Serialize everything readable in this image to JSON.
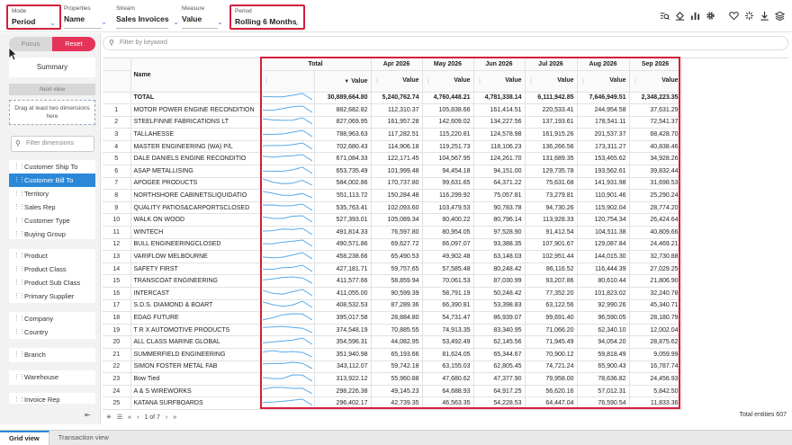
{
  "toolbar": {
    "mode": {
      "label": "Mode",
      "value": "Period"
    },
    "properties": {
      "label": "Properties",
      "value": "Name"
    },
    "stream": {
      "label": "Stream",
      "value": "Sales Invoices"
    },
    "measure": {
      "label": "Measure",
      "value": "Value"
    },
    "period": {
      "label": "Period",
      "value": "Rolling 6 Months"
    },
    "icons": [
      "search-list-icon",
      "paint-bucket-icon",
      "bar-chart-icon",
      "gear-icon",
      "heart-icon",
      "sparkle-icon",
      "download-icon",
      "layers-icon"
    ]
  },
  "left": {
    "focus_label": "Focus",
    "reset_label": "Reset",
    "summary_label": "Summary",
    "next_view_label": "Next view",
    "drag_hint": "Drag at least two dimensions here",
    "filter_placeholder": "Filter dimensions",
    "groups": [
      [
        "Customer Ship To",
        "Customer Bill To",
        "Territory",
        "Sales Rep",
        "Customer Type",
        "Buying Group"
      ],
      [
        "Product",
        "Product Class",
        "Product Sub Class",
        "Primary Supplier"
      ],
      [
        "Company",
        "Country"
      ],
      [
        "Branch"
      ],
      [
        "Warehouse"
      ],
      [
        "Invoice Rep"
      ]
    ],
    "selected": "Customer Bill To"
  },
  "search": {
    "placeholder": "Filter by keyword"
  },
  "grid": {
    "name_header": "Name",
    "value_header": "Value",
    "columns": [
      "Total",
      "Apr 2026",
      "May 2026",
      "Jun 2026",
      "Jul 2026",
      "Aug 2026",
      "Sep 2026"
    ],
    "total_row": {
      "name": "TOTAL",
      "values": [
        "30,889,664.80",
        "5,240,762.74",
        "4,760,448.21",
        "4,781,338.14",
        "6,111,942.85",
        "7,646,949.51",
        "2,348,223.35"
      ]
    },
    "rows": [
      {
        "i": "1",
        "name": "MOTOR POWER ENGINE RECONDITION",
        "values": [
          "882,682.82",
          "112,310.37",
          "105,838.66",
          "161,414.51",
          "220,533.41",
          "244,954.58",
          "37,631.29"
        ]
      },
      {
        "i": "2",
        "name": "STEELFINNE FABRICATIONS LT",
        "values": [
          "827,069.95",
          "161,957.28",
          "142,609.02",
          "134,227.56",
          "137,193.61",
          "178,541.11",
          "72,541.37"
        ]
      },
      {
        "i": "3",
        "name": "TALLAHESSE",
        "values": [
          "788,963.63",
          "117,282.51",
          "115,220.81",
          "124,578.98",
          "161,915.26",
          "201,537.37",
          "68,428.70"
        ]
      },
      {
        "i": "4",
        "name": "MASTER ENGINEERING (WA) P/L",
        "values": [
          "702,680.43",
          "114,906.18",
          "119,251.73",
          "118,106.23",
          "136,266.56",
          "173,311.27",
          "40,838.46"
        ]
      },
      {
        "i": "5",
        "name": "DALE DANIELS ENGINE RECONDITIO",
        "values": [
          "671,084.33",
          "122,171.45",
          "104,567.95",
          "124,261.70",
          "131,689.35",
          "153,465.62",
          "34,928.26"
        ]
      },
      {
        "i": "6",
        "name": "ASAP METALLISING",
        "values": [
          "653,735.49",
          "101,999.48",
          "94,454.18",
          "94,151.00",
          "129,735.78",
          "193,562.61",
          "39,832.44"
        ]
      },
      {
        "i": "7",
        "name": "APOGEE PRODUCTS",
        "values": [
          "584,002.86",
          "170,737.80",
          "99,631.65",
          "64,371.22",
          "75,631.68",
          "141,931.98",
          "31,698.53"
        ]
      },
      {
        "i": "8",
        "name": "NORTHSHORE CABINETSLIQUIDATIO",
        "values": [
          "551,113.72",
          "150,284.48",
          "116,299.92",
          "75,057.81",
          "73,279.81",
          "110,901.46",
          "25,290.24"
        ]
      },
      {
        "i": "9",
        "name": "QUALITY PATIOS&CARPORTSCLOSED",
        "values": [
          "535,763.41",
          "102,093.60",
          "103,479.53",
          "90,783.78",
          "94,730.26",
          "115,902.04",
          "28,774.20"
        ]
      },
      {
        "i": "10",
        "name": "WALK ON WOOD",
        "values": [
          "527,393.01",
          "105,089.34",
          "80,400.22",
          "80,796.14",
          "113,928.33",
          "120,754.34",
          "26,424.64"
        ]
      },
      {
        "i": "11",
        "name": "WINTECH",
        "values": [
          "491,814.33",
          "76,597.80",
          "80,954.05",
          "97,528.90",
          "91,412.54",
          "104,511.38",
          "40,809.66"
        ]
      },
      {
        "i": "12",
        "name": "BULL ENGINEERINGCLOSED",
        "values": [
          "490,571.86",
          "69,627.72",
          "66,097.07",
          "93,388.35",
          "107,901.67",
          "129,087.84",
          "24,469.21"
        ]
      },
      {
        "i": "13",
        "name": "VARIFLOW MELBOURNE",
        "values": [
          "458,238.66",
          "65,490.53",
          "49,902.48",
          "63,148.03",
          "102,951.44",
          "144,015.30",
          "32,730.88"
        ]
      },
      {
        "i": "14",
        "name": "SAFETY FIRST",
        "values": [
          "427,181.71",
          "59,757.65",
          "57,585.48",
          "80,248.42",
          "86,116.52",
          "116,444.39",
          "27,029.25"
        ]
      },
      {
        "i": "15",
        "name": "TRANSCOAT ENGINEERING",
        "values": [
          "411,577.66",
          "58,859.94",
          "70,061.53",
          "87,030.99",
          "93,207.86",
          "80,610.44",
          "21,806.90"
        ]
      },
      {
        "i": "16",
        "name": "INTERCAST",
        "values": [
          "411,055.00",
          "90,599.39",
          "58,791.19",
          "50,248.42",
          "77,352.20",
          "101,823.02",
          "32,240.78"
        ]
      },
      {
        "i": "17",
        "name": "S.D.S. DIAMOND & BOART",
        "values": [
          "408,532.53",
          "87,289.36",
          "66,390.81",
          "53,398.83",
          "63,122.56",
          "92,990.26",
          "45,340.71"
        ]
      },
      {
        "i": "18",
        "name": "EDAG FUTURE",
        "values": [
          "395,017.58",
          "28,884.80",
          "54,731.47",
          "86,939.07",
          "99,691.40",
          "96,590.05",
          "28,180.79"
        ]
      },
      {
        "i": "19",
        "name": "T R X AUTOMOTIVE PRODUCTS",
        "values": [
          "374,548.19",
          "70,885.55",
          "74,913.35",
          "83,340.95",
          "71,066.20",
          "62,340.10",
          "12,002.04"
        ]
      },
      {
        "i": "20",
        "name": "ALL CLASS MARINE GLOBAL",
        "values": [
          "354,596.31",
          "44,082.95",
          "53,492.49",
          "62,145.56",
          "71,945.49",
          "94,054.20",
          "28,875.62"
        ]
      },
      {
        "i": "21",
        "name": "SUMMERFIELD ENGINEERING",
        "values": [
          "351,940.98",
          "65,193.66",
          "81,624.05",
          "65,344.67",
          "70,900.12",
          "59,818.49",
          "9,059.99"
        ]
      },
      {
        "i": "22",
        "name": "SIMON FOSTER METAL FAB",
        "values": [
          "343,112.07",
          "59,742.18",
          "63,155.03",
          "62,805.45",
          "74,721.24",
          "65,900.43",
          "16,787.74"
        ]
      },
      {
        "i": "23",
        "name": "Bow Tied",
        "values": [
          "313,922.12",
          "55,960.88",
          "47,680.62",
          "47,377.90",
          "79,958.00",
          "78,636.82",
          "24,456.93"
        ]
      },
      {
        "i": "24",
        "name": "A & S WIREWORKS",
        "values": [
          "298,226.38",
          "49,145.23",
          "64,688.93",
          "64,917.25",
          "56,620.16",
          "57,012.31",
          "5,842.50"
        ]
      },
      {
        "i": "25",
        "name": "KATANA SURFBOARDS",
        "values": [
          "296,402.17",
          "42,739.35",
          "46,563.35",
          "54,228.53",
          "64,447.04",
          "76,590.54",
          "11,833.36"
        ]
      }
    ]
  },
  "pager": {
    "text": "1 of 7"
  },
  "status": {
    "total_entities": "Total entities 607"
  },
  "tabs": {
    "grid": "Grid view",
    "transaction": "Transaction view"
  },
  "colors": {
    "accent": "#2b88d8",
    "reset": "#e6335a",
    "highlight": "#d21f3c",
    "spark": "#5aa9e6"
  }
}
